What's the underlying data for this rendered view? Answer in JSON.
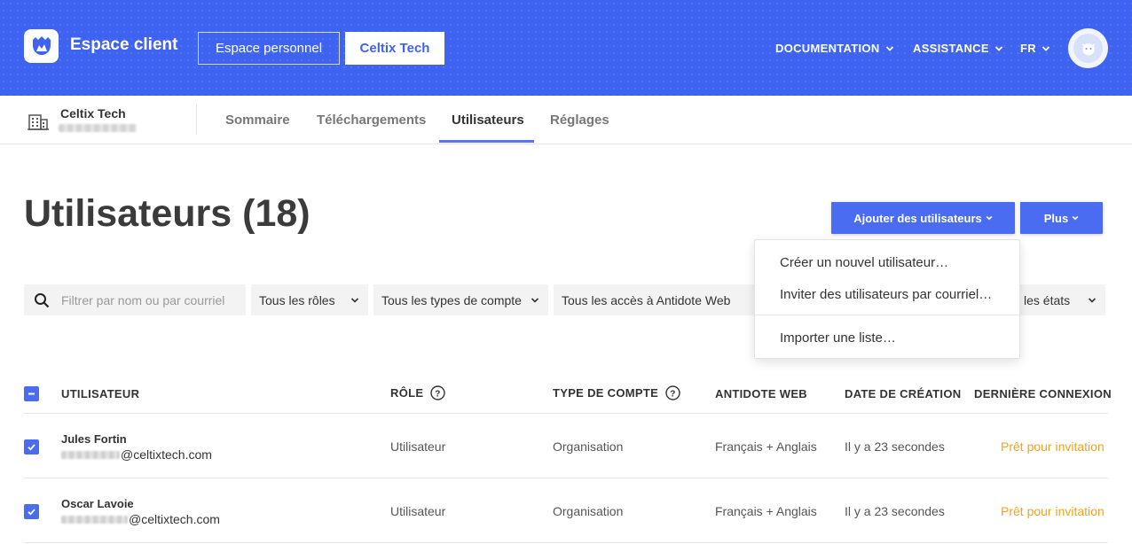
{
  "header": {
    "app_title": "Espace client",
    "personal_button": "Espace personnel",
    "org_button": "Celtix Tech",
    "menu": [
      {
        "label": "DOCUMENTATION"
      },
      {
        "label": "ASSISTANCE"
      },
      {
        "label": "FR"
      }
    ],
    "brand_color": "#3e63f1"
  },
  "subnav": {
    "org_name": "Celtix Tech",
    "tabs": [
      {
        "label": "Sommaire",
        "active": false
      },
      {
        "label": "Téléchargements",
        "active": false
      },
      {
        "label": "Utilisateurs",
        "active": true
      },
      {
        "label": "Réglages",
        "active": false
      }
    ]
  },
  "page": {
    "title": "Utilisateurs (18)",
    "add_button": "Ajouter des utilisateurs",
    "more_button": "Plus"
  },
  "filters": {
    "search_placeholder": "Filtrer par nom ou par courriel",
    "roles": "Tous les rôles",
    "account_types": "Tous les types de compte",
    "antidote_access": "Tous les accès à Antidote Web",
    "states": "les états"
  },
  "dropdown": {
    "items": [
      "Créer un nouvel utilisateur…",
      "Inviter des utilisateurs par courriel…",
      "Importer une liste…"
    ]
  },
  "table": {
    "headers": {
      "user": "UTILISATEUR",
      "role": "RÔLE",
      "account_type": "TYPE DE COMPTE",
      "antidote": "ANTIDOTE WEB",
      "created": "DATE DE CRÉATION",
      "last_login": "DERNIÈRE CONNEXION"
    },
    "rows": [
      {
        "name": "Jules Fortin",
        "email_domain": "@celtixtech.com",
        "role": "Utilisateur",
        "account_type": "Organisation",
        "antidote": "Français + Anglais",
        "created": "Il y a 23 secondes",
        "last_login": "Prêt pour invitation",
        "checked": true
      },
      {
        "name": "Oscar Lavoie",
        "email_domain": "@celtixtech.com",
        "role": "Utilisateur",
        "account_type": "Organisation",
        "antidote": "Français + Anglais",
        "created": "Il y a 23 secondes",
        "last_login": "Prêt pour invitation",
        "checked": true
      }
    ],
    "status_color": "#f1a31e"
  }
}
